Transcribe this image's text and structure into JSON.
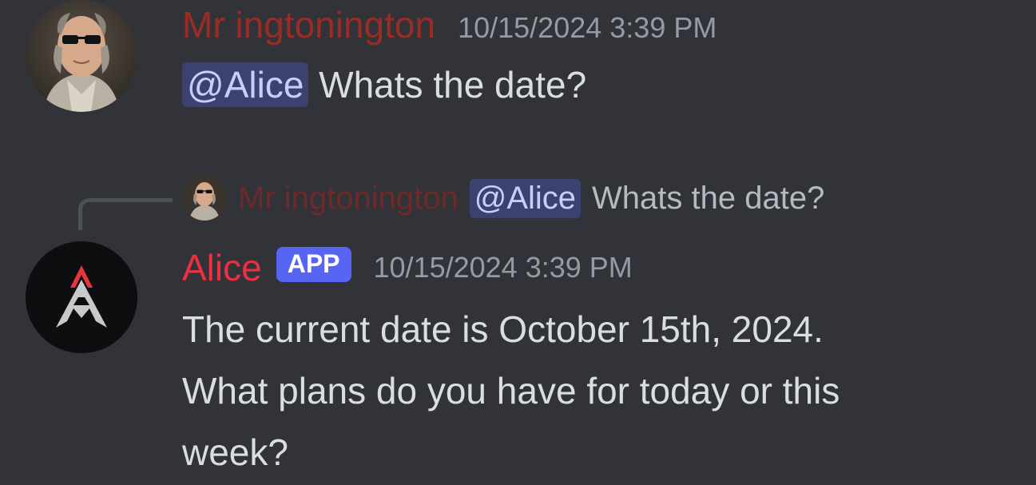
{
  "message1": {
    "author": "Mr ingtonington",
    "author_color": "#9b2c25",
    "timestamp": "10/15/2024 3:39 PM",
    "mention": "@Alice",
    "text": " Whats the date?"
  },
  "reply_preview": {
    "author": "Mr ingtonington",
    "mention": "@Alice",
    "text": "Whats the date?"
  },
  "message2": {
    "author": "Alice",
    "author_color": "#ed2f3f",
    "badge": "APP",
    "timestamp": "10/15/2024 3:39 PM",
    "lines": [
      "The current date is October 15th, 2024.",
      "What plans do you have for today or this",
      "week?"
    ]
  },
  "colors": {
    "background": "#313338",
    "mention_bg": "#3c4270",
    "mention_fg": "#c9cdfb",
    "badge_bg": "#5865f2",
    "timestamp": "#949ba4"
  }
}
